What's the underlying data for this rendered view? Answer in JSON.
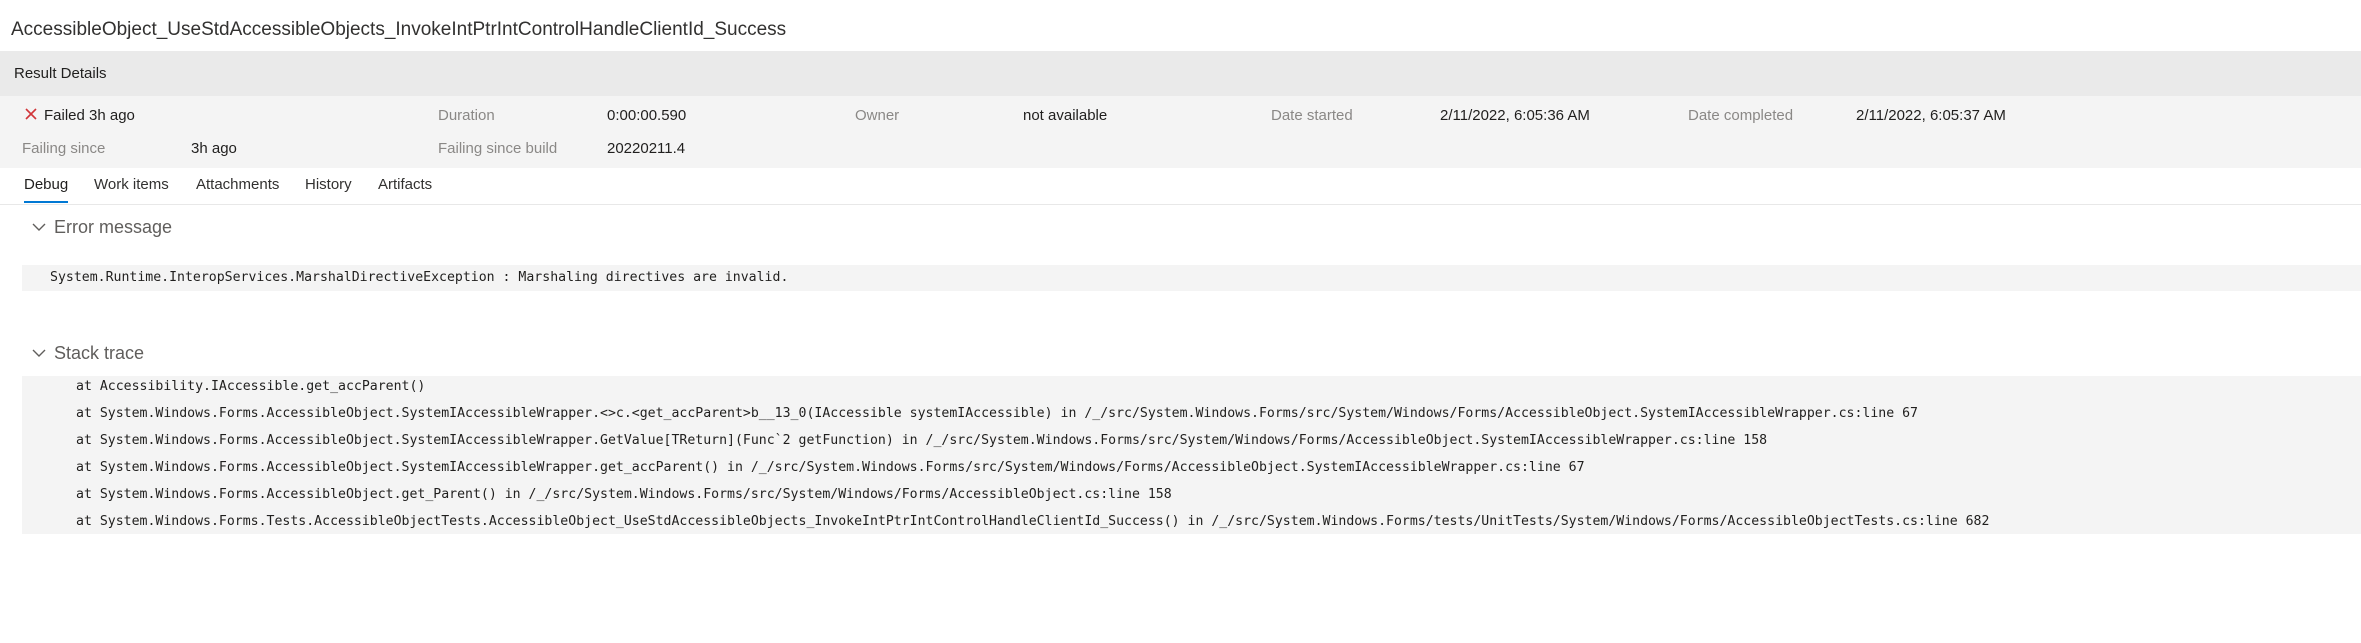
{
  "page_title": "AccessibleObject_UseStdAccessibleObjects_InvokeIntPtrIntControlHandleClientId_Success",
  "result_details_label": "Result Details",
  "summary": {
    "status_icon": "x-icon",
    "status_text": "Failed 3h ago",
    "duration_label": "Duration",
    "duration_value": "0:00:00.590",
    "owner_label": "Owner",
    "owner_value": "not available",
    "date_started_label": "Date started",
    "date_started_value": "2/11/2022, 6:05:36 AM",
    "date_completed_label": "Date completed",
    "date_completed_value": "2/11/2022, 6:05:37 AM",
    "failing_since_label": "Failing since",
    "failing_since_value": "3h ago",
    "failing_since_build_label": "Failing since build",
    "failing_since_build_value": "20220211.4"
  },
  "tabs": [
    {
      "label": "Debug",
      "active": true
    },
    {
      "label": "Work items",
      "active": false
    },
    {
      "label": "Attachments",
      "active": false
    },
    {
      "label": "History",
      "active": false
    },
    {
      "label": "Artifacts",
      "active": false
    }
  ],
  "error_section": {
    "title": "Error message",
    "icon": "chevron-down-icon",
    "message": "System.Runtime.InteropServices.MarshalDirectiveException : Marshaling directives are invalid."
  },
  "stack_section": {
    "title": "Stack trace",
    "icon": "chevron-down-icon",
    "lines": [
      "at Accessibility.IAccessible.get_accParent()",
      "at System.Windows.Forms.AccessibleObject.SystemIAccessibleWrapper.<>c.<get_accParent>b__13_0(IAccessible systemIAccessible) in /_/src/System.Windows.Forms/src/System/Windows/Forms/AccessibleObject.SystemIAccessibleWrapper.cs:line 67",
      "at System.Windows.Forms.AccessibleObject.SystemIAccessibleWrapper.GetValue[TReturn](Func`2 getFunction) in /_/src/System.Windows.Forms/src/System/Windows/Forms/AccessibleObject.SystemIAccessibleWrapper.cs:line 158",
      "at System.Windows.Forms.AccessibleObject.SystemIAccessibleWrapper.get_accParent() in /_/src/System.Windows.Forms/src/System/Windows/Forms/AccessibleObject.SystemIAccessibleWrapper.cs:line 67",
      "at System.Windows.Forms.AccessibleObject.get_Parent() in /_/src/System.Windows.Forms/src/System/Windows/Forms/AccessibleObject.cs:line 158",
      "at System.Windows.Forms.Tests.AccessibleObjectTests.AccessibleObject_UseStdAccessibleObjects_InvokeIntPtrIntControlHandleClientId_Success() in /_/src/System.Windows.Forms/tests/UnitTests/System/Windows/Forms/AccessibleObjectTests.cs:line 682"
    ]
  },
  "colors": {
    "failed": "#d13438",
    "accent": "#0078d4",
    "header_bg": "#eaeaea",
    "panel_bg": "#f4f4f4"
  }
}
